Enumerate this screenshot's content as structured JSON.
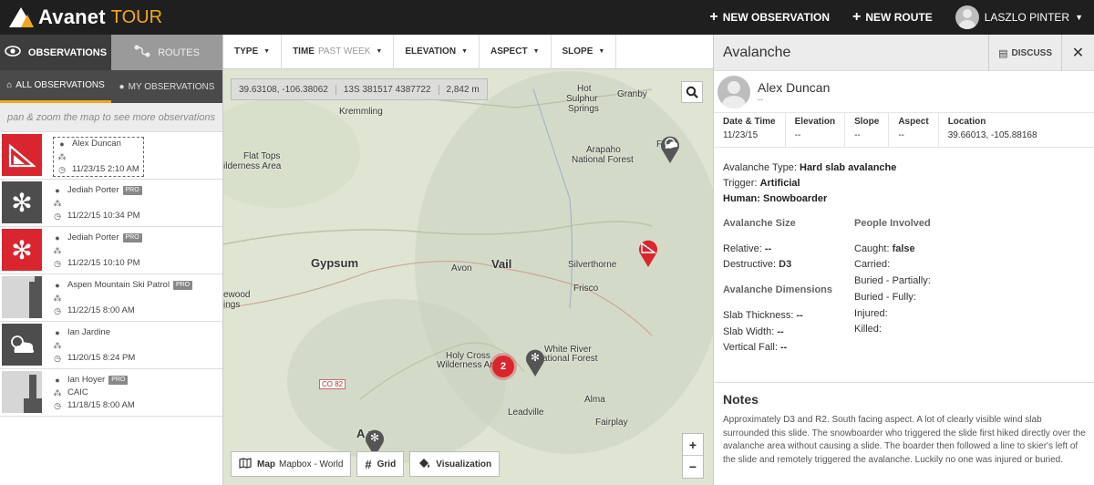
{
  "header": {
    "brand": "Avanet",
    "brand_sub": "TOUR",
    "new_observation": "NEW OBSERVATION",
    "new_route": "NEW ROUTE",
    "user_name": "LASZLO PINTER"
  },
  "left": {
    "tabs": [
      {
        "label": "OBSERVATIONS",
        "icon": "eye-icon"
      },
      {
        "label": "ROUTES",
        "icon": "route-icon"
      }
    ],
    "subtabs": [
      {
        "label": "ALL OBSERVATIONS",
        "icon": "binoculars-icon"
      },
      {
        "label": "MY OBSERVATIONS",
        "icon": "user-icon"
      }
    ],
    "hint": "pan & zoom the map to see more observations",
    "observations": [
      {
        "name": "Alex Duncan",
        "pro": "",
        "org": "",
        "date": "11/23/15 2:10 AM",
        "thumb": "avalanche"
      },
      {
        "name": "Jediah Porter",
        "pro": "PRO",
        "org": "",
        "date": "11/22/15 10:34 PM",
        "thumb": "snowflake-dark"
      },
      {
        "name": "Jediah Porter",
        "pro": "PRO",
        "org": "",
        "date": "11/22/15 10:10 PM",
        "thumb": "snowflake-red"
      },
      {
        "name": "Aspen Mountain Ski Patrol",
        "pro": "PRO",
        "org": "",
        "date": "11/22/15 8:00 AM",
        "thumb": "profile"
      },
      {
        "name": "Ian Jardine",
        "pro": "",
        "org": "",
        "date": "11/20/15 8:24 PM",
        "thumb": "cloud"
      },
      {
        "name": "Ian Hoyer",
        "pro": "PRO",
        "org": "CAIC",
        "date": "11/18/15 8:00 AM",
        "thumb": "profile2"
      }
    ]
  },
  "filters": [
    {
      "label": "TYPE",
      "extra": ""
    },
    {
      "label": "TIME",
      "extra": "PAST WEEK"
    },
    {
      "label": "ELEVATION",
      "extra": ""
    },
    {
      "label": "ASPECT",
      "extra": ""
    },
    {
      "label": "SLOPE",
      "extra": ""
    }
  ],
  "map": {
    "coord_latlon": "39.63108, -106.38062",
    "coord_utm": "13S 381517 4387722",
    "coord_elev": "2,842 m",
    "cluster_count": "2",
    "labels": {
      "kremmling": "Kremmling",
      "hot_sulphur": "Hot",
      "hot_sulphur2": "Sulphur",
      "hot_sulphur3": "Springs",
      "granby": "Granby",
      "flat_tops": "Flat Tops",
      "flat_tops2": "ilderness Area",
      "arapaho": "Arapaho",
      "arapaho2": "National Forest",
      "gypsum": "Gypsum",
      "avon": "Avon",
      "vail": "Vail",
      "silverthorne": "Silverthorne",
      "frisco": "Frisco",
      "wood": "ewood",
      "wood2": "ings",
      "holy_cross": "Holy Cross",
      "holy_cross2": "Wilderness Are",
      "white_river": "White River",
      "white_river2": "ational Forest",
      "alma": "Alma",
      "leadville": "Leadville",
      "fairplay": "Fairplay",
      "co82": "CO 82",
      "aspen": "A   n",
      "fr": "Fr"
    },
    "tools": {
      "map_label": "Map",
      "map_source": "Mapbox - World",
      "grid": "Grid",
      "visualization": "Visualization"
    },
    "zoom_in": "+",
    "zoom_out": "−"
  },
  "detail": {
    "title": "Avalanche",
    "discuss": "DISCUSS",
    "author": "Alex Duncan",
    "author_sub": "--",
    "stats": [
      {
        "label": "Date & Time",
        "value": "11/23/15"
      },
      {
        "label": "Elevation",
        "value": "--"
      },
      {
        "label": "Slope",
        "value": "--"
      },
      {
        "label": "Aspect",
        "value": "--"
      },
      {
        "label": "Location",
        "value": "39.66013, -105.88168"
      }
    ],
    "type_label": "Avalanche Type:",
    "type_value": "Hard slab avalanche",
    "trigger_label": "Trigger:",
    "trigger_value": "Artificial",
    "human_label": "Human:",
    "human_value": "Snowboarder",
    "size_heading": "Avalanche Size",
    "relative_label": "Relative:",
    "relative_value": "--",
    "destructive_label": "Destructive:",
    "destructive_value": "D3",
    "dims_heading": "Avalanche Dimensions",
    "slab_thickness_label": "Slab Thickness:",
    "slab_thickness_value": "--",
    "slab_width_label": "Slab Width:",
    "slab_width_value": "--",
    "vertical_fall_label": "Vertical Fall:",
    "vertical_fall_value": "--",
    "people_heading": "People Involved",
    "caught_label": "Caught:",
    "caught_value": "false",
    "carried_label": "Carried:",
    "buried_partially_label": "Buried - Partially:",
    "buried_fully_label": "Buried - Fully:",
    "injured_label": "Injured:",
    "killed_label": "Killed:",
    "notes_heading": "Notes",
    "notes_text": "Approximately D3 and R2. South facing aspect. A lot of clearly visible wind slab surrounded this slide. The snowboarder who triggered the slide first hiked directly over the avalanche area without causing a slide. The boarder then followed a line to skier's left of the slide and remotely triggered the avalanche. Luckily no one was injured or buried."
  },
  "colors": {
    "accent": "#f3a81c",
    "danger": "#d9262e",
    "topbar": "#1f1f1f"
  }
}
